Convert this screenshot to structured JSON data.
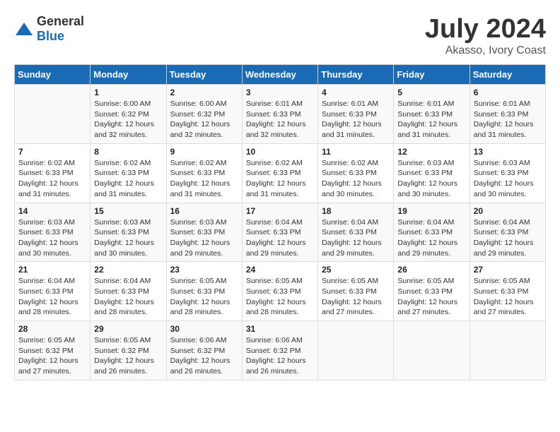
{
  "header": {
    "logo_general": "General",
    "logo_blue": "Blue",
    "title": "July 2024",
    "subtitle": "Akasso, Ivory Coast"
  },
  "days_of_week": [
    "Sunday",
    "Monday",
    "Tuesday",
    "Wednesday",
    "Thursday",
    "Friday",
    "Saturday"
  ],
  "weeks": [
    [
      {
        "day": "",
        "info": ""
      },
      {
        "day": "1",
        "info": "Sunrise: 6:00 AM\nSunset: 6:32 PM\nDaylight: 12 hours\nand 32 minutes."
      },
      {
        "day": "2",
        "info": "Sunrise: 6:00 AM\nSunset: 6:32 PM\nDaylight: 12 hours\nand 32 minutes."
      },
      {
        "day": "3",
        "info": "Sunrise: 6:01 AM\nSunset: 6:33 PM\nDaylight: 12 hours\nand 32 minutes."
      },
      {
        "day": "4",
        "info": "Sunrise: 6:01 AM\nSunset: 6:33 PM\nDaylight: 12 hours\nand 31 minutes."
      },
      {
        "day": "5",
        "info": "Sunrise: 6:01 AM\nSunset: 6:33 PM\nDaylight: 12 hours\nand 31 minutes."
      },
      {
        "day": "6",
        "info": "Sunrise: 6:01 AM\nSunset: 6:33 PM\nDaylight: 12 hours\nand 31 minutes."
      }
    ],
    [
      {
        "day": "7",
        "info": "Sunrise: 6:02 AM\nSunset: 6:33 PM\nDaylight: 12 hours\nand 31 minutes."
      },
      {
        "day": "8",
        "info": "Sunrise: 6:02 AM\nSunset: 6:33 PM\nDaylight: 12 hours\nand 31 minutes."
      },
      {
        "day": "9",
        "info": "Sunrise: 6:02 AM\nSunset: 6:33 PM\nDaylight: 12 hours\nand 31 minutes."
      },
      {
        "day": "10",
        "info": "Sunrise: 6:02 AM\nSunset: 6:33 PM\nDaylight: 12 hours\nand 31 minutes."
      },
      {
        "day": "11",
        "info": "Sunrise: 6:02 AM\nSunset: 6:33 PM\nDaylight: 12 hours\nand 30 minutes."
      },
      {
        "day": "12",
        "info": "Sunrise: 6:03 AM\nSunset: 6:33 PM\nDaylight: 12 hours\nand 30 minutes."
      },
      {
        "day": "13",
        "info": "Sunrise: 6:03 AM\nSunset: 6:33 PM\nDaylight: 12 hours\nand 30 minutes."
      }
    ],
    [
      {
        "day": "14",
        "info": "Sunrise: 6:03 AM\nSunset: 6:33 PM\nDaylight: 12 hours\nand 30 minutes."
      },
      {
        "day": "15",
        "info": "Sunrise: 6:03 AM\nSunset: 6:33 PM\nDaylight: 12 hours\nand 30 minutes."
      },
      {
        "day": "16",
        "info": "Sunrise: 6:03 AM\nSunset: 6:33 PM\nDaylight: 12 hours\nand 29 minutes."
      },
      {
        "day": "17",
        "info": "Sunrise: 6:04 AM\nSunset: 6:33 PM\nDaylight: 12 hours\nand 29 minutes."
      },
      {
        "day": "18",
        "info": "Sunrise: 6:04 AM\nSunset: 6:33 PM\nDaylight: 12 hours\nand 29 minutes."
      },
      {
        "day": "19",
        "info": "Sunrise: 6:04 AM\nSunset: 6:33 PM\nDaylight: 12 hours\nand 29 minutes."
      },
      {
        "day": "20",
        "info": "Sunrise: 6:04 AM\nSunset: 6:33 PM\nDaylight: 12 hours\nand 29 minutes."
      }
    ],
    [
      {
        "day": "21",
        "info": "Sunrise: 6:04 AM\nSunset: 6:33 PM\nDaylight: 12 hours\nand 28 minutes."
      },
      {
        "day": "22",
        "info": "Sunrise: 6:04 AM\nSunset: 6:33 PM\nDaylight: 12 hours\nand 28 minutes."
      },
      {
        "day": "23",
        "info": "Sunrise: 6:05 AM\nSunset: 6:33 PM\nDaylight: 12 hours\nand 28 minutes."
      },
      {
        "day": "24",
        "info": "Sunrise: 6:05 AM\nSunset: 6:33 PM\nDaylight: 12 hours\nand 28 minutes."
      },
      {
        "day": "25",
        "info": "Sunrise: 6:05 AM\nSunset: 6:33 PM\nDaylight: 12 hours\nand 27 minutes."
      },
      {
        "day": "26",
        "info": "Sunrise: 6:05 AM\nSunset: 6:33 PM\nDaylight: 12 hours\nand 27 minutes."
      },
      {
        "day": "27",
        "info": "Sunrise: 6:05 AM\nSunset: 6:33 PM\nDaylight: 12 hours\nand 27 minutes."
      }
    ],
    [
      {
        "day": "28",
        "info": "Sunrise: 6:05 AM\nSunset: 6:32 PM\nDaylight: 12 hours\nand 27 minutes."
      },
      {
        "day": "29",
        "info": "Sunrise: 6:05 AM\nSunset: 6:32 PM\nDaylight: 12 hours\nand 26 minutes."
      },
      {
        "day": "30",
        "info": "Sunrise: 6:06 AM\nSunset: 6:32 PM\nDaylight: 12 hours\nand 26 minutes."
      },
      {
        "day": "31",
        "info": "Sunrise: 6:06 AM\nSunset: 6:32 PM\nDaylight: 12 hours\nand 26 minutes."
      },
      {
        "day": "",
        "info": ""
      },
      {
        "day": "",
        "info": ""
      },
      {
        "day": "",
        "info": ""
      }
    ]
  ]
}
